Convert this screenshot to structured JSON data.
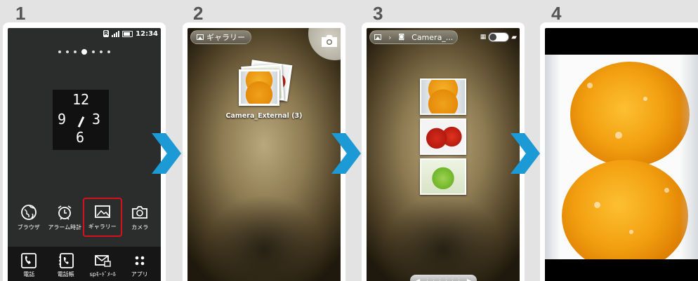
{
  "steps": [
    {
      "number": "1"
    },
    {
      "number": "2"
    },
    {
      "number": "3"
    },
    {
      "number": "4"
    }
  ],
  "colors": {
    "arrow": "#1b9ad6",
    "highlight": "#d8101e",
    "page_background": "#e3e3e3"
  },
  "screen1": {
    "status": {
      "time": "12:34",
      "badge": "R"
    },
    "home_page_dots": {
      "count": 7,
      "active": 3
    },
    "clock_widget": {
      "hour_top": "12",
      "left": "9",
      "right": "3",
      "bottom": "6"
    },
    "apps": [
      {
        "label": "ブラウザ",
        "icon": "globe-icon"
      },
      {
        "label": "アラーム時計",
        "icon": "alarm-clock-icon"
      },
      {
        "label": "ギャラリー",
        "icon": "picture-icon",
        "highlighted": true
      },
      {
        "label": "カメラ",
        "icon": "camera-icon"
      }
    ],
    "dock": [
      {
        "label": "電話",
        "icon": "phone-icon"
      },
      {
        "label": "電話帳",
        "icon": "phonebook-icon"
      },
      {
        "label": "spﾓｰﾄﾞﾒｰﾙ",
        "icon": "mail-icon"
      },
      {
        "label": "アプリ",
        "icon": "apps-icon"
      }
    ]
  },
  "screen2": {
    "breadcrumb": "ギャラリー",
    "album": {
      "name": "Camera_External",
      "count": "(3)",
      "label": "Camera_External (3)"
    },
    "camera_button_icon": "camera-icon"
  },
  "screen3": {
    "breadcrumb_album": "Camera_...",
    "thumbnails": [
      "orange",
      "tomato",
      "green-apple"
    ]
  },
  "screen4": {
    "photo_subject": "oranges in water"
  }
}
